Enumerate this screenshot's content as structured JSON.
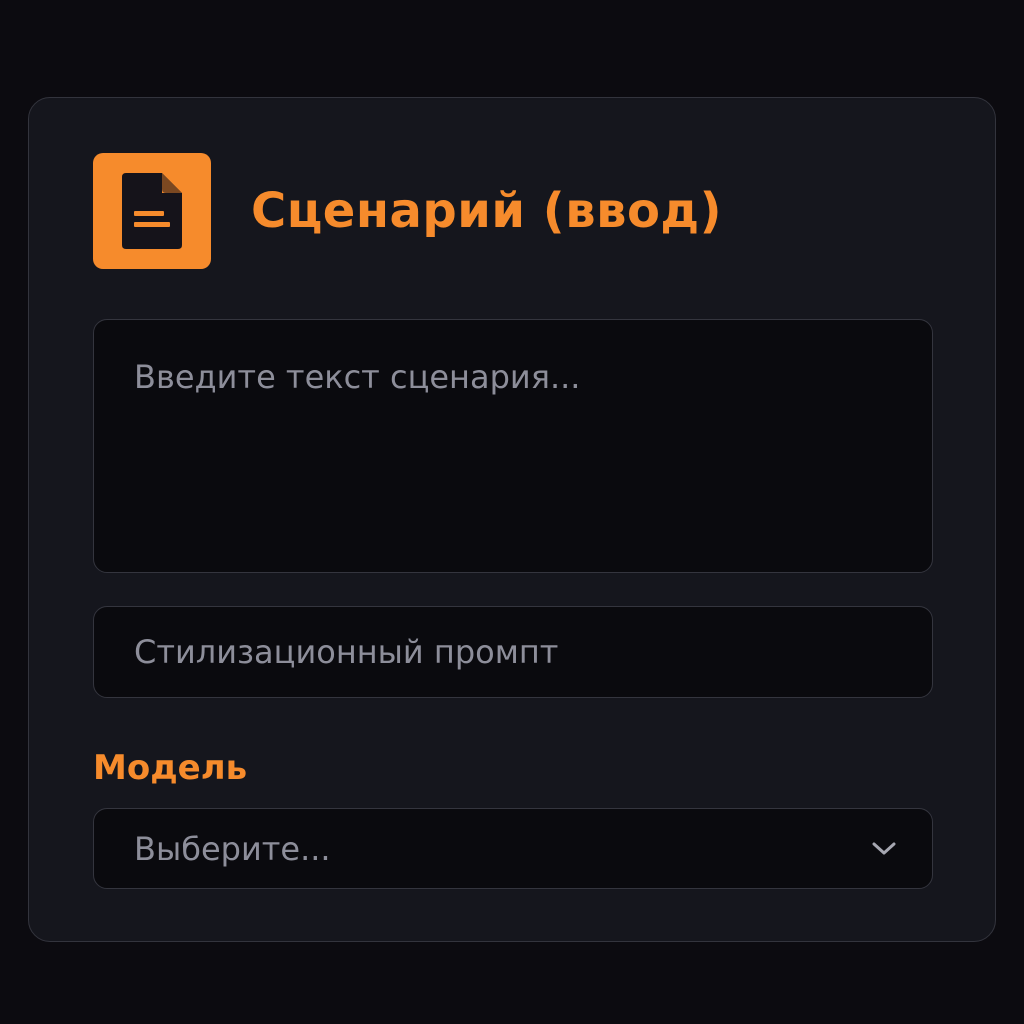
{
  "card": {
    "title": "Сценарий (ввод)",
    "title_icon": "document-icon",
    "script_textarea": {
      "placeholder": "Введите текст сценария...",
      "value": ""
    },
    "style_prompt_input": {
      "placeholder": "Стилизационный промпт",
      "value": ""
    },
    "model_field": {
      "label": "Модель",
      "selected": "Выберите...",
      "dropdown_icon": "chevron-down-icon"
    }
  },
  "colors": {
    "accent": "#f68b2c",
    "page_background": "#0c0b10",
    "card_background": "#15161d",
    "field_background": "#0a0a0e",
    "placeholder_text": "#8d8e9a",
    "border": "#34353e"
  }
}
